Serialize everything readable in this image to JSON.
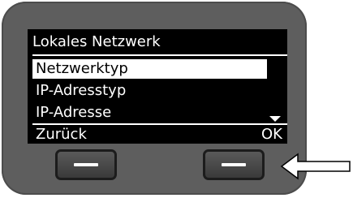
{
  "screen": {
    "title": "Lokales Netzwerk",
    "menu_items": [
      {
        "label": "Netzwerktyp",
        "selected": true
      },
      {
        "label": "IP-Adresstyp",
        "selected": false
      },
      {
        "label": "IP-Adresse",
        "selected": false
      }
    ],
    "softkeys": {
      "left": "Zurück",
      "right": "OK"
    }
  },
  "icons": {
    "scroll": "scroll-down-arrow-icon",
    "softkey_left": "softkey-line-icon",
    "softkey_right": "softkey-line-icon",
    "pointer": "arrow-left-icon"
  },
  "colors": {
    "bezel": "#5e5e5e",
    "screen_background": "#000000",
    "screen_text": "#ffffff",
    "selection_background": "#ffffff",
    "selection_text": "#000000"
  }
}
